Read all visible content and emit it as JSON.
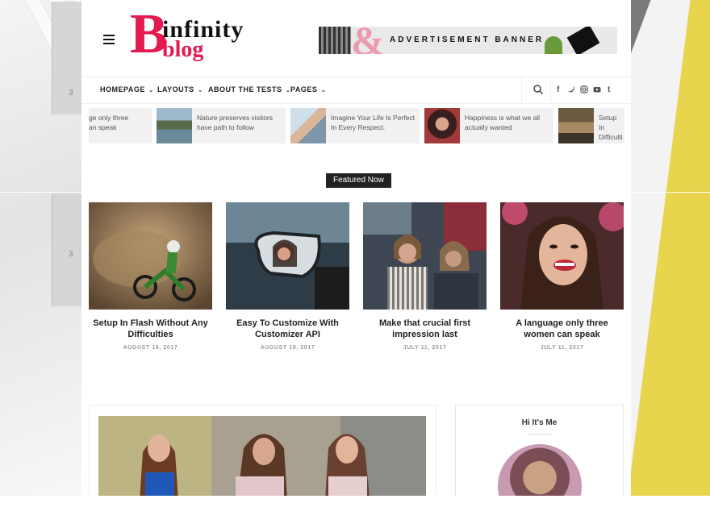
{
  "logo": {
    "letter": "B",
    "word1": "infinity",
    "word2": "blog"
  },
  "ad_banner": {
    "text": "ADVERTISEMENT BANNER",
    "mark": "&"
  },
  "nav": {
    "items": [
      {
        "label": "HOMEPAGE",
        "chevron": "chevron-down-icon"
      },
      {
        "label": "LAYOUTS",
        "chevron": "chevron-down-icon"
      },
      {
        "label": "ABOUT THE TESTS",
        "chevron": "chevron-down-icon"
      },
      {
        "label": "PAGES",
        "chevron": "chevron-down-icon"
      }
    ],
    "social": [
      "f",
      "t",
      "ig",
      "yt",
      "t"
    ]
  },
  "ticker": [
    {
      "text": "ge only three\nan speak"
    },
    {
      "text": "Nature preserves visitors have path to follow"
    },
    {
      "text": "Imagine Your Life Is Perfect In Every Respect."
    },
    {
      "text": "Happiness is what we all actually wanted"
    },
    {
      "text": "Setup In\nDifficulti"
    }
  ],
  "featured": {
    "label": "Featured Now",
    "posts": [
      {
        "title": "Setup In Flash Without Any Difficulties",
        "date": "AUGUST 18, 2017"
      },
      {
        "title": "Easy To Customize With Customizer API",
        "date": "AUGUST 18, 2017"
      },
      {
        "title": "Make that crucial first impression last",
        "date": "JULY 11, 2017"
      },
      {
        "title": "A language only three women can speak",
        "date": "JULY 11, 2017"
      }
    ]
  },
  "sidebar": {
    "widget_title": "Hi It's Me"
  }
}
